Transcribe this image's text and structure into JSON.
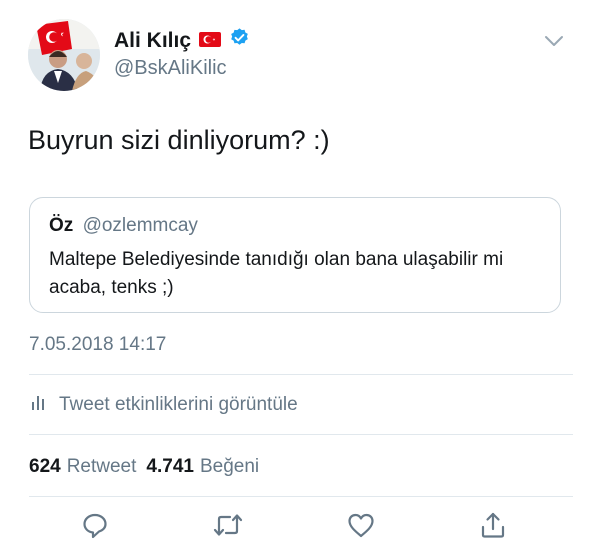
{
  "author": {
    "display_name": "Ali Kılıç",
    "handle": "@BskAliKilic"
  },
  "tweet": {
    "text": "Buyrun sizi dinliyorum? :)",
    "timestamp": "7.05.2018 14:17"
  },
  "quoted_tweet": {
    "display_name": "Öz",
    "handle": "@ozlemmcay",
    "text": "Maltepe Belediyesinde tanıdığı olan bana ulaşabilir mi acaba, tenks ;)"
  },
  "activity": {
    "label": "Tweet etkinliklerini görüntüle"
  },
  "stats": {
    "retweets_count": "624",
    "retweets_label": "Retweet",
    "likes_count": "4.741",
    "likes_label": "Beğeni"
  },
  "colors": {
    "primary_text": "#14171a",
    "secondary_text": "#657786",
    "verified_blue": "#1da1f2",
    "flag_red": "#e30a17",
    "divider": "#e1e8ed"
  },
  "icons": [
    "turkish-flag-emoji",
    "verified-badge-icon",
    "chevron-down-icon",
    "analytics-icon",
    "reply-icon",
    "retweet-icon",
    "like-icon",
    "share-icon"
  ]
}
